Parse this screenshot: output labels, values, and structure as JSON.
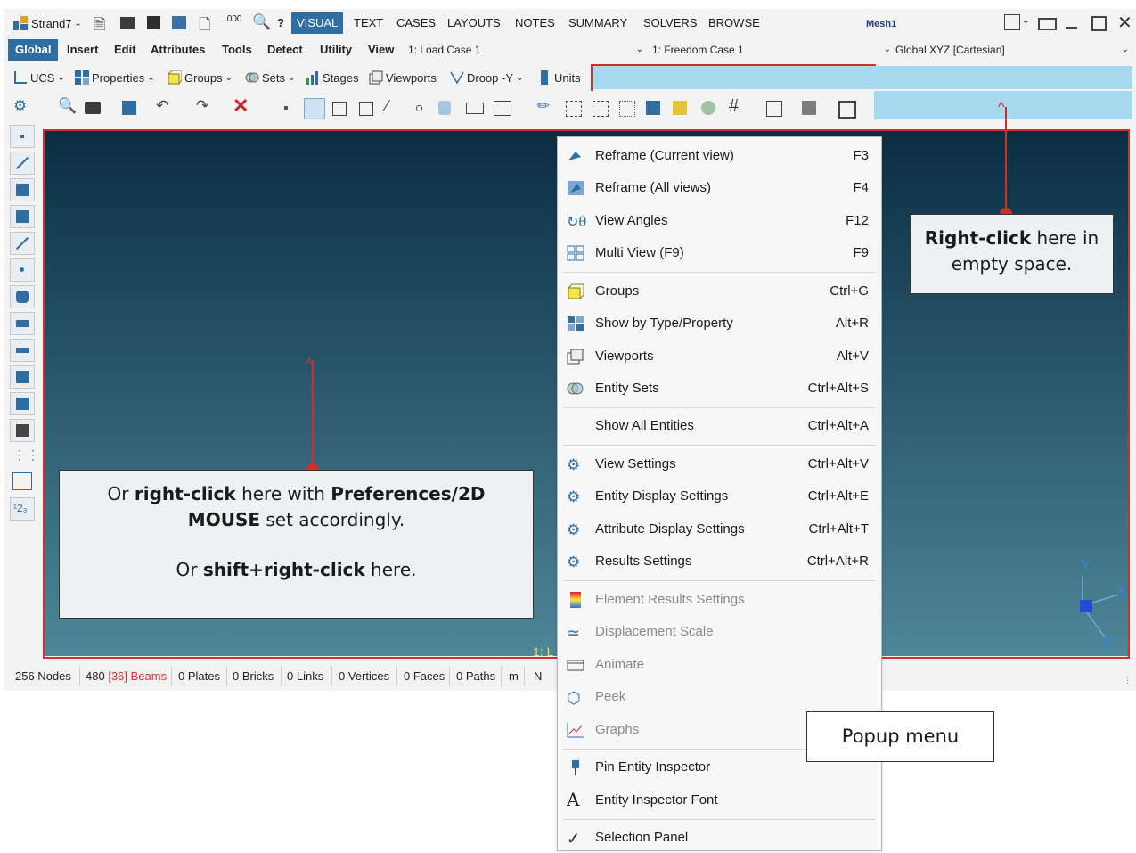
{
  "title_tabs": {
    "app_name": "Strand7",
    "tabs": [
      "VISUAL",
      "TEXT",
      "CASES",
      "LAYOUTS",
      "NOTES",
      "SUMMARY",
      "SOLVERS",
      "BROWSE"
    ],
    "active_tab": "VISUAL",
    "model_name": "Mesh1"
  },
  "menus": {
    "items": [
      "Global",
      "Insert",
      "Edit",
      "Attributes",
      "Tools",
      "Detect",
      "Utility",
      "View"
    ],
    "active": "Global",
    "load_case": "1: Load Case 1",
    "freedom_case": "1: Freedom Case 1",
    "coord_system": "Global XYZ [Cartesian]"
  },
  "toolbar1": {
    "ucs": "UCS",
    "properties": "Properties",
    "groups": "Groups",
    "sets": "Sets",
    "stages": "Stages",
    "viewports": "Viewports",
    "droop": "Droop -Y",
    "units": "Units"
  },
  "viewport": {
    "label": "1: L",
    "axes": {
      "y": "Y",
      "x": "X",
      "z": "Z"
    }
  },
  "status": {
    "nodes": "256 Nodes",
    "beams_count": "480",
    "beams_highlight": "[36]",
    "beams_label": "Beams",
    "plates": "0 Plates",
    "bricks": "0 Bricks",
    "links": "0 Links",
    "vertices": "0 Vertices",
    "faces": "0 Faces",
    "paths": "0 Paths",
    "unit_m": "m",
    "unit_n": "N"
  },
  "popup_menu": {
    "items": [
      {
        "label": "Reframe (Current view)",
        "key": "F3",
        "disabled": false
      },
      {
        "label": "Reframe (All views)",
        "key": "F4",
        "disabled": false
      },
      {
        "label": "View Angles",
        "key": "F12",
        "disabled": false
      },
      {
        "label": "Multi View (F9)",
        "key": "F9",
        "disabled": false
      },
      {
        "label": "Groups",
        "key": "Ctrl+G",
        "disabled": false
      },
      {
        "label": "Show by Type/Property",
        "key": "Alt+R",
        "disabled": false
      },
      {
        "label": "Viewports",
        "key": "Alt+V",
        "disabled": false
      },
      {
        "label": "Entity Sets",
        "key": "Ctrl+Alt+S",
        "disabled": false
      },
      {
        "label": "Show All Entities",
        "key": "Ctrl+Alt+A",
        "disabled": false
      },
      {
        "label": "View Settings",
        "key": "Ctrl+Alt+V",
        "disabled": false
      },
      {
        "label": "Entity Display Settings",
        "key": "Ctrl+Alt+E",
        "disabled": false
      },
      {
        "label": "Attribute Display Settings",
        "key": "Ctrl+Alt+T",
        "disabled": false
      },
      {
        "label": "Results Settings",
        "key": "Ctrl+Alt+R",
        "disabled": false
      },
      {
        "label": "Element Results Settings",
        "key": "",
        "disabled": true
      },
      {
        "label": "Displacement Scale",
        "key": "",
        "disabled": true
      },
      {
        "label": "Animate",
        "key": "",
        "disabled": true
      },
      {
        "label": "Peek",
        "key": "",
        "disabled": true
      },
      {
        "label": "Graphs",
        "key": "",
        "disabled": true
      },
      {
        "label": "Pin Entity Inspector",
        "key": "",
        "disabled": false
      },
      {
        "label": "Entity Inspector Font",
        "key": "",
        "disabled": false
      },
      {
        "label": "Selection Panel",
        "key": "",
        "disabled": false
      }
    ]
  },
  "annotations": {
    "right_top_bold": "Right-click",
    "right_top_rest1": " here in",
    "right_top_rest2": "empty space.",
    "left_line1_a": "Or ",
    "left_line1_b": "right-click",
    "left_line1_c": " here with ",
    "left_line1_d": "Preferences/2D",
    "left_line2_a": "MOUSE",
    "left_line2_b": " set accordingly.",
    "left_line3_a": "Or ",
    "left_line3_b": "shift+right-click",
    "left_line3_c": " here.",
    "popup_label": "Popup menu"
  },
  "colors": {
    "accent": "#2e6ea3",
    "callout_red": "#d0302c",
    "highlight_fill": "#a6d9ef"
  }
}
